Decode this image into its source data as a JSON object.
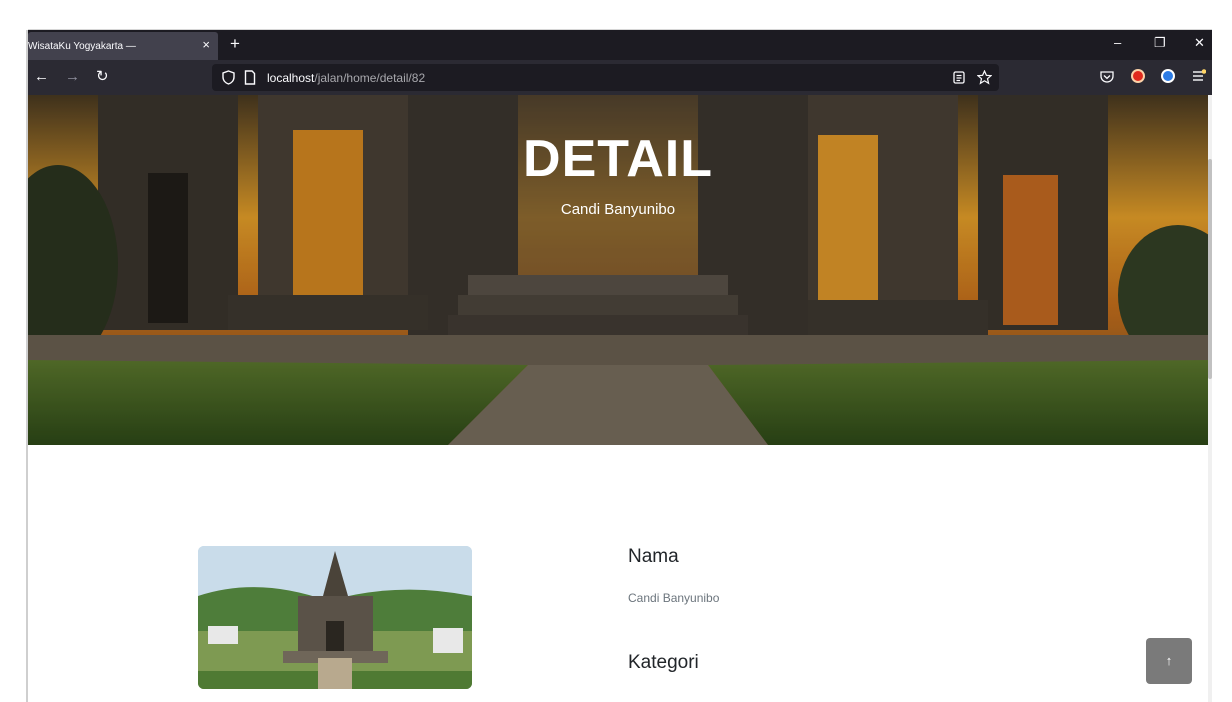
{
  "browser": {
    "tab_title": "WisataKu Yogyakarta —",
    "tab_close": "×",
    "new_tab": "+",
    "window_controls": {
      "minimize": "–",
      "restore": "❐",
      "close": "✕"
    },
    "nav": {
      "back": "←",
      "forward": "→",
      "reload": "↻"
    },
    "url_host": "localhost",
    "url_path": "/jalan/home/detail/82",
    "icons": [
      "shield-icon",
      "page-icon",
      "reader-view-icon",
      "bookmark-star-icon",
      "pocket-icon",
      "extension-red-icon",
      "extension-blue-icon",
      "menu-icon"
    ]
  },
  "hero": {
    "title": "DETAIL",
    "subtitle": "Candi Banyunibo"
  },
  "detail": {
    "name_label": "Nama",
    "name_value": "Candi Banyunibo",
    "category_label": "Kategori"
  },
  "back_to_top": "↑",
  "colors": {
    "tab_strip": "#1c1b22",
    "nav_bar": "#2b2a33",
    "active_tab": "#42414d",
    "back_to_top": "#7a7a7a",
    "label_text": "#212529",
    "muted_text": "#6c757d"
  }
}
